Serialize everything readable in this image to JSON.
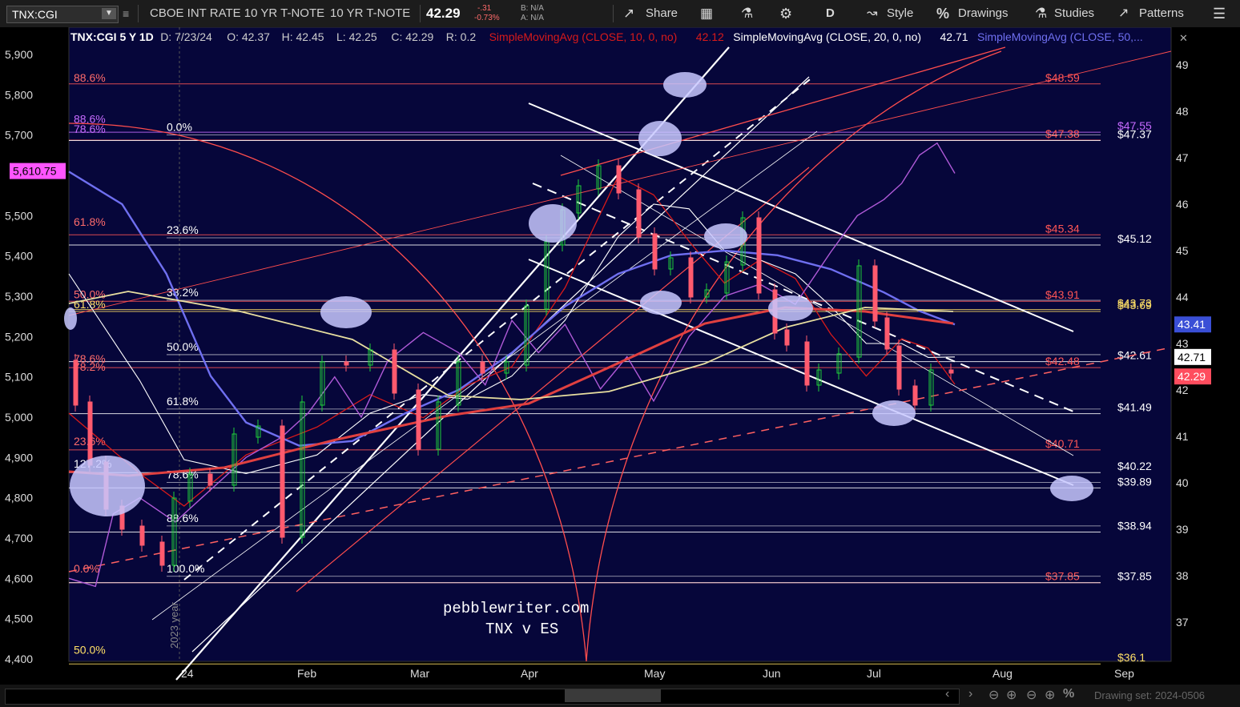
{
  "toolbar": {
    "symbol": "TNX:CGI",
    "description": "CBOE INT RATE 10 YR T-NOTE",
    "short_name": "10 YR T-NOTE",
    "last": "42.29",
    "change": "-.31",
    "change_pct": "-0.73%",
    "bid": "B: N/A",
    "ask": "A: N/A",
    "share_label": "Share",
    "aggregation": "D",
    "style_label": "Style",
    "drawings_label": "Drawings",
    "studies_label": "Studies",
    "patterns_label": "Patterns"
  },
  "header": {
    "title": "TNX:CGI 5 Y 1D",
    "date": "D: 7/23/24",
    "open": "O: 42.37",
    "high": "H: 42.45",
    "low": "L: 42.25",
    "close": "C: 42.29",
    "range": "R: 0.2",
    "sma10": "SimpleMovingAvg (CLOSE, 10, 0, no)",
    "sma10_val": "42.12",
    "sma20": "SimpleMovingAvg (CLOSE, 20, 0, no)",
    "sma20_val": "42.71",
    "sma50": "SimpleMovingAvg (CLOSE, 50,..."
  },
  "watermark": [
    "pebblewriter.com",
    "TNX v ES"
  ],
  "vertical_note": "2023 year",
  "drawing_set": "Drawing set: 2024-0506",
  "colors": {
    "background": "#06063a",
    "candle_up": "#1fcf3a",
    "candle_down": "#ff5a6e",
    "sma10": "#d81a1a",
    "sma20": "#ffffff",
    "sma50": "#6f6ff0",
    "es_line": "#b05ad8",
    "fib_red": "#ff5555",
    "fib_white": "#ffffff",
    "fib_yellow": "#ffe066",
    "ellipse": "#c8c8ff"
  },
  "chart_data": {
    "type": "line",
    "x_ticks": [
      "24",
      "Feb",
      "Mar",
      "Apr",
      "May",
      "Jun",
      "Jul",
      "Aug",
      "Sep"
    ],
    "left_axis": {
      "ticks": [
        "5,900",
        "5,800",
        "5,700",
        "5,500",
        "5,400",
        "5,300",
        "5,200",
        "5,100",
        "5,000",
        "4,900",
        "4,800",
        "4,700",
        "4,600",
        "4,500",
        "4,400"
      ],
      "range": [
        4400,
        5900
      ],
      "current_label": "5,610.75"
    },
    "right_axis": {
      "ticks": [
        "49",
        "48",
        "47",
        "46",
        "45",
        "44",
        "43",
        "42",
        "41",
        "40",
        "39",
        "38",
        "37"
      ],
      "range": [
        36.1,
        49.4
      ],
      "badges": [
        {
          "text": "43.41",
          "value": 43.41,
          "color": "#3a4fd6"
        },
        {
          "text": "42.71",
          "value": 42.71,
          "color": "#ffffff"
        },
        {
          "text": "42.29",
          "value": 42.29,
          "color": "#ff4d5e"
        }
      ]
    },
    "fib_left_labels": [
      {
        "text": "88.6%",
        "es": 5832,
        "color": "#ff6b6b"
      },
      {
        "text": "88.6%",
        "es": 5730,
        "color": "#c76bff"
      },
      {
        "text": "78.6%",
        "es": 5705,
        "color": "#c76bff"
      },
      {
        "text": "61.8%",
        "es": 5475,
        "color": "#ff6b6b"
      },
      {
        "text": "50.0%",
        "es": 5295,
        "color": "#ff6b6b"
      },
      {
        "text": "61.8%",
        "es": 5270,
        "color": "#ffe066"
      },
      {
        "text": "78.6%",
        "es": 5135,
        "color": "#ff6b6b"
      },
      {
        "text": "78.2%",
        "es": 5115,
        "color": "#ff6b6b"
      },
      {
        "text": "23.6%",
        "es": 4930,
        "color": "#ff6b6b"
      },
      {
        "text": "127.2%",
        "es": 4875,
        "color": "#ffffff"
      },
      {
        "text": "0.0%",
        "es": 4615,
        "color": "#ff6b6b"
      },
      {
        "text": "50.0%",
        "es": 4413,
        "color": "#ffe066"
      }
    ],
    "fib_mid_labels": [
      {
        "text": "0.0%",
        "es": 5710
      },
      {
        "text": "23.6%",
        "es": 5455
      },
      {
        "text": "38.2%",
        "es": 5300
      },
      {
        "text": "50.0%",
        "es": 5165
      },
      {
        "text": "61.8%",
        "es": 5030
      },
      {
        "text": "78.6%",
        "es": 4848
      },
      {
        "text": "88.6%",
        "es": 4740
      },
      {
        "text": "100.0%",
        "es": 4615
      }
    ],
    "price_levels": [
      {
        "text": "$48.59",
        "value": 48.59,
        "color": "#ff5555"
      },
      {
        "text": "$47.55",
        "value": 47.55,
        "color": "#c76bff"
      },
      {
        "text": "$47.38",
        "value": 47.38,
        "color": "#ff5555"
      },
      {
        "text": "$47.37",
        "value": 47.37,
        "color": "#ffffff"
      },
      {
        "text": "$45.34",
        "value": 45.34,
        "color": "#ff5555"
      },
      {
        "text": "$45.12",
        "value": 45.12,
        "color": "#ffffff"
      },
      {
        "text": "$43.91",
        "value": 43.91,
        "color": "#ff5555"
      },
      {
        "text": "$43.73",
        "value": 43.73,
        "color": "#ffe066"
      },
      {
        "text": "$43.69",
        "value": 43.69,
        "color": "#ffe066"
      },
      {
        "text": "$42.61",
        "value": 42.61,
        "color": "#ffffff"
      },
      {
        "text": "$42.48",
        "value": 42.48,
        "color": "#ff5555"
      },
      {
        "text": "$41.49",
        "value": 41.49,
        "color": "#ffffff"
      },
      {
        "text": "$40.71",
        "value": 40.71,
        "color": "#ff5555"
      },
      {
        "text": "$40.22",
        "value": 40.22,
        "color": "#ffffff"
      },
      {
        "text": "$39.89",
        "value": 39.89,
        "color": "#ffffff"
      },
      {
        "text": "$38.94",
        "value": 38.94,
        "color": "#ffffff"
      },
      {
        "text": "$37.85",
        "value": 37.85,
        "color": "#ff5555"
      },
      {
        "text": "$37.85",
        "value": 37.85,
        "color": "#ffffff"
      },
      {
        "text": "$36.1",
        "value": 36.1,
        "color": "#ffe066"
      }
    ],
    "series": [
      {
        "name": "SimpleMovingAvg (CLOSE, 10, 0, no)",
        "axis": "right",
        "color": "#d81a1a",
        "points": [
          [
            0.0,
            41.5
          ],
          [
            0.08,
            40.2
          ],
          [
            0.13,
            39.5
          ],
          [
            0.2,
            40.6
          ],
          [
            0.28,
            41.2
          ],
          [
            0.34,
            41.9
          ],
          [
            0.4,
            41.4
          ],
          [
            0.45,
            42.1
          ],
          [
            0.5,
            42.5
          ],
          [
            0.56,
            44.2
          ],
          [
            0.62,
            46.6
          ],
          [
            0.66,
            46.2
          ],
          [
            0.7,
            45.2
          ],
          [
            0.74,
            44.3
          ],
          [
            0.78,
            44.8
          ],
          [
            0.82,
            44.4
          ],
          [
            0.86,
            43.2
          ],
          [
            0.9,
            42.3
          ],
          [
            0.94,
            43.1
          ],
          [
            0.97,
            42.9
          ],
          [
            1.0,
            42.12
          ]
        ]
      },
      {
        "name": "SimpleMovingAvg (CLOSE, 20, 0, no)",
        "axis": "right",
        "color": "#ffffff",
        "points": [
          [
            0.0,
            44.5
          ],
          [
            0.08,
            42.2
          ],
          [
            0.13,
            40.5
          ],
          [
            0.2,
            40.2
          ],
          [
            0.28,
            40.6
          ],
          [
            0.34,
            41.5
          ],
          [
            0.4,
            41.9
          ],
          [
            0.45,
            41.8
          ],
          [
            0.5,
            42.3
          ],
          [
            0.56,
            43.5
          ],
          [
            0.62,
            45.3
          ],
          [
            0.66,
            46.0
          ],
          [
            0.7,
            45.9
          ],
          [
            0.74,
            45.0
          ],
          [
            0.78,
            44.8
          ],
          [
            0.82,
            44.5
          ],
          [
            0.86,
            43.8
          ],
          [
            0.9,
            43.0
          ],
          [
            0.94,
            43.0
          ],
          [
            0.97,
            42.7
          ],
          [
            1.0,
            42.71
          ]
        ]
      },
      {
        "name": "SimpleMovingAvg (CLOSE, 50,...",
        "axis": "right",
        "color": "#6f6ff0",
        "points": [
          [
            0.0,
            46.7
          ],
          [
            0.06,
            46.0
          ],
          [
            0.11,
            44.5
          ],
          [
            0.16,
            42.3
          ],
          [
            0.2,
            41.3
          ],
          [
            0.26,
            40.8
          ],
          [
            0.32,
            40.9
          ],
          [
            0.38,
            41.5
          ],
          [
            0.44,
            42.0
          ],
          [
            0.5,
            42.8
          ],
          [
            0.56,
            43.8
          ],
          [
            0.62,
            44.5
          ],
          [
            0.68,
            44.9
          ],
          [
            0.74,
            45.0
          ],
          [
            0.8,
            44.9
          ],
          [
            0.86,
            44.6
          ],
          [
            0.92,
            44.1
          ],
          [
            0.96,
            43.7
          ],
          [
            1.0,
            43.41
          ]
        ]
      },
      {
        "name": "ES",
        "axis": "left",
        "color": "#b05ad8",
        "points": [
          [
            0.0,
            4600
          ],
          [
            0.03,
            4580
          ],
          [
            0.05,
            4760
          ],
          [
            0.08,
            4800
          ],
          [
            0.12,
            4740
          ],
          [
            0.16,
            4820
          ],
          [
            0.2,
            4900
          ],
          [
            0.24,
            4950
          ],
          [
            0.27,
            5010
          ],
          [
            0.3,
            5100
          ],
          [
            0.33,
            5000
          ],
          [
            0.36,
            5140
          ],
          [
            0.4,
            5210
          ],
          [
            0.44,
            5160
          ],
          [
            0.47,
            5080
          ],
          [
            0.5,
            5240
          ],
          [
            0.53,
            5160
          ],
          [
            0.56,
            5230
          ],
          [
            0.6,
            5070
          ],
          [
            0.63,
            5150
          ],
          [
            0.66,
            5040
          ],
          [
            0.7,
            5200
          ],
          [
            0.74,
            5300
          ],
          [
            0.78,
            5330
          ],
          [
            0.82,
            5280
          ],
          [
            0.86,
            5410
          ],
          [
            0.89,
            5500
          ],
          [
            0.92,
            5540
          ],
          [
            0.94,
            5580
          ],
          [
            0.96,
            5650
          ],
          [
            0.98,
            5680
          ],
          [
            1.0,
            5605
          ]
        ]
      }
    ],
    "annotations": [
      "pebblewriter.com",
      "TNX v ES",
      "2023 year"
    ]
  }
}
